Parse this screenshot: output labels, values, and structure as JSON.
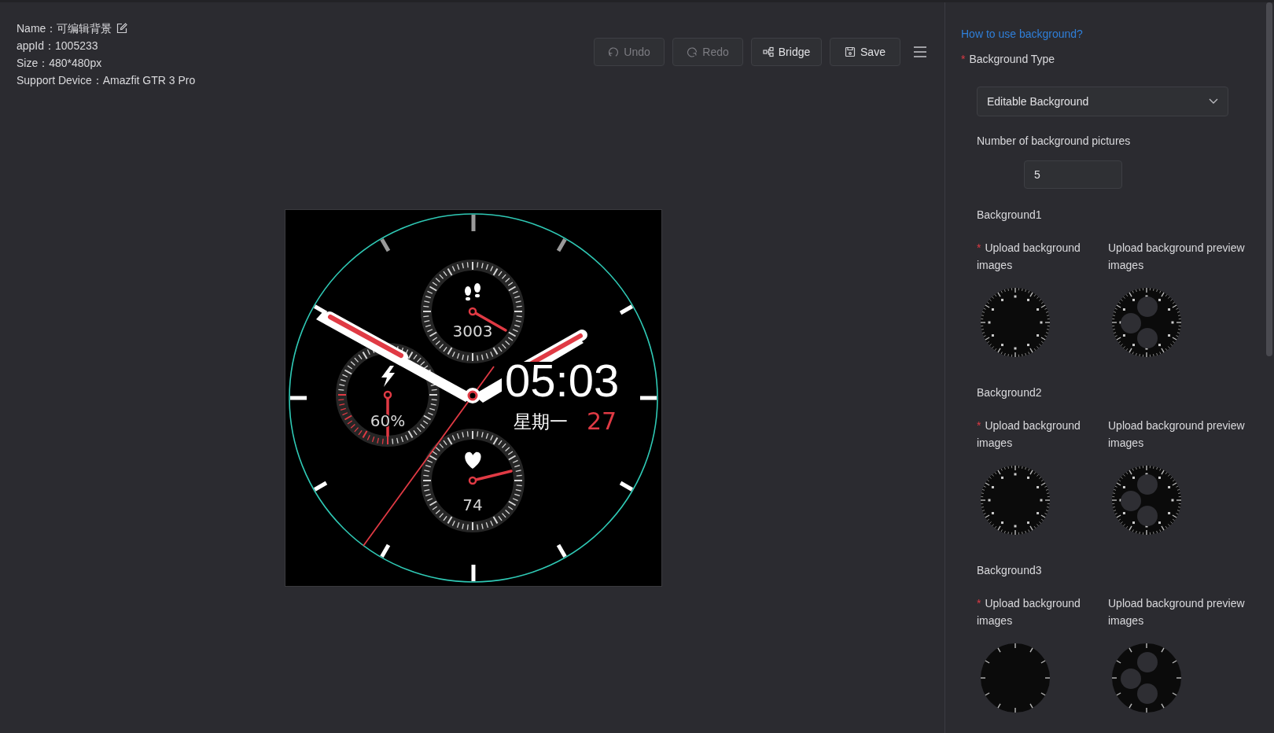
{
  "project": {
    "name": {
      "label": "Name：",
      "value": "可编辑背景"
    },
    "fields": [
      {
        "label": "appId：",
        "value": "1005233"
      },
      {
        "label": "Size：",
        "value": "480*480px"
      },
      {
        "label": "Support Device：",
        "value": "Amazfit GTR 3 Pro"
      }
    ]
  },
  "toolbar": [
    {
      "label": "Undo",
      "kind": "undo",
      "disabled": true
    },
    {
      "label": "Redo",
      "kind": "redo",
      "disabled": true
    },
    {
      "label": "Bridge",
      "kind": "bridge",
      "disabled": false
    },
    {
      "label": "Save",
      "kind": "save",
      "disabled": false
    }
  ],
  "watch_face": {
    "steps": "3003",
    "battery": "60%",
    "heart_rate": "74",
    "time": "05:03",
    "weekday": "星期一",
    "day": "27"
  },
  "panel": {
    "help_link": "How to use background?",
    "background_type": {
      "label": "Background Type",
      "required_mark": "*",
      "value": "Editable Background"
    },
    "count": {
      "label": "Number of background pictures",
      "value": "5"
    },
    "backgrounds": [
      {
        "title": "Background1",
        "upload": {
          "label": "Upload background images",
          "required_mark": "*"
        },
        "preview": {
          "label": "Upload background preview images"
        },
        "kind": "numbered"
      },
      {
        "title": "Background2",
        "upload": {
          "label": "Upload background images",
          "required_mark": "*"
        },
        "preview": {
          "label": "Upload background preview images"
        },
        "kind": "numbered"
      },
      {
        "title": "Background3",
        "upload": {
          "label": "Upload background images",
          "required_mark": "*"
        },
        "preview": {
          "label": "Upload background preview images"
        },
        "kind": "simple"
      }
    ]
  }
}
